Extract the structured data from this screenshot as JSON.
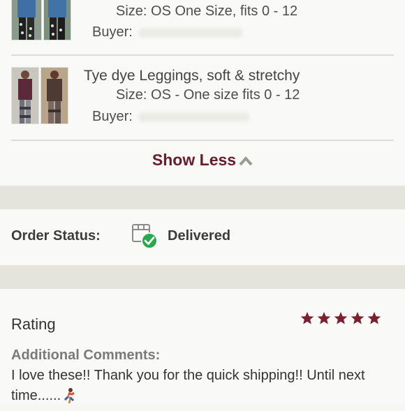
{
  "items": [
    {
      "size": "Size: OS One Size, fits 0 - 12",
      "buyer_label": "Buyer:"
    },
    {
      "title": "Tye dye Leggings, soft & stretchy",
      "size": "Size: OS - One size fits 0 - 12",
      "buyer_label": "Buyer:"
    }
  ],
  "show_less": {
    "label": "Show Less",
    "icon": "chevron-up-icon"
  },
  "order_status": {
    "label": "Order Status:",
    "value": "Delivered",
    "icon": "box-delivered-icon"
  },
  "rating": {
    "label": "Rating",
    "stars": 5,
    "max_stars": 5,
    "comments_label": "Additional Comments:",
    "comments_text": "I love these!! Thank you for the quick shipping!! Until next time......",
    "emoji": "runner-emoji"
  },
  "colors": {
    "accent": "#6a1b2c",
    "star": "#7a2130",
    "delivered_check": "#2aa84a"
  }
}
